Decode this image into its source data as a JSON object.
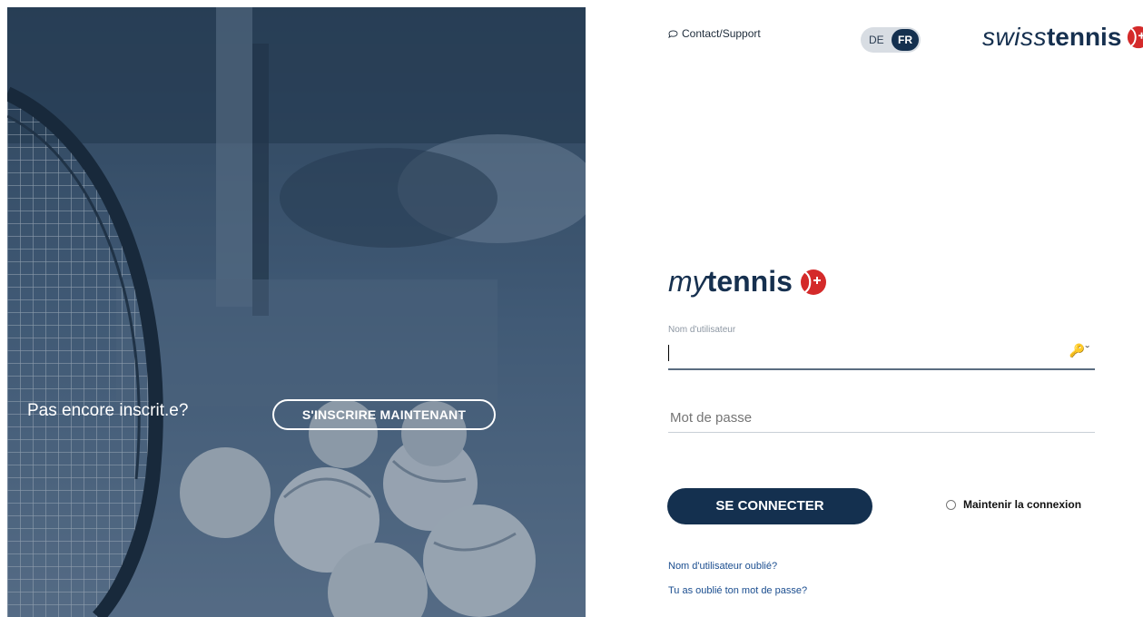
{
  "hero": {
    "prompt": "Pas encore inscrit.e?",
    "signup_label": "S'INSCRIRE MAINTENANT"
  },
  "topbar": {
    "contact_label": "Contact/Support",
    "lang_de": "DE",
    "lang_fr": "FR",
    "brand_swiss": "swiss",
    "brand_tennis": "tennis"
  },
  "app_logo": {
    "my": "my",
    "tennis": "tennis"
  },
  "form": {
    "username_label": "Nom d'utilisateur",
    "username_value": "",
    "password_placeholder": "Mot de passe",
    "login_label": "SE CONNECTER",
    "remember_label": "Maintenir la connexion",
    "forgot_username": "Nom d'utilisateur oublié?",
    "forgot_password": "Tu as oublié ton mot de passe?"
  },
  "icons": {
    "chat": "chat-bubble-icon",
    "ball": "tennis-ball-icon",
    "key": "key-icon"
  },
  "colors": {
    "brand_navy": "#14304f",
    "brand_red": "#d42a2a",
    "hero_tint": "#3f5670",
    "link": "#1a4d8f"
  }
}
